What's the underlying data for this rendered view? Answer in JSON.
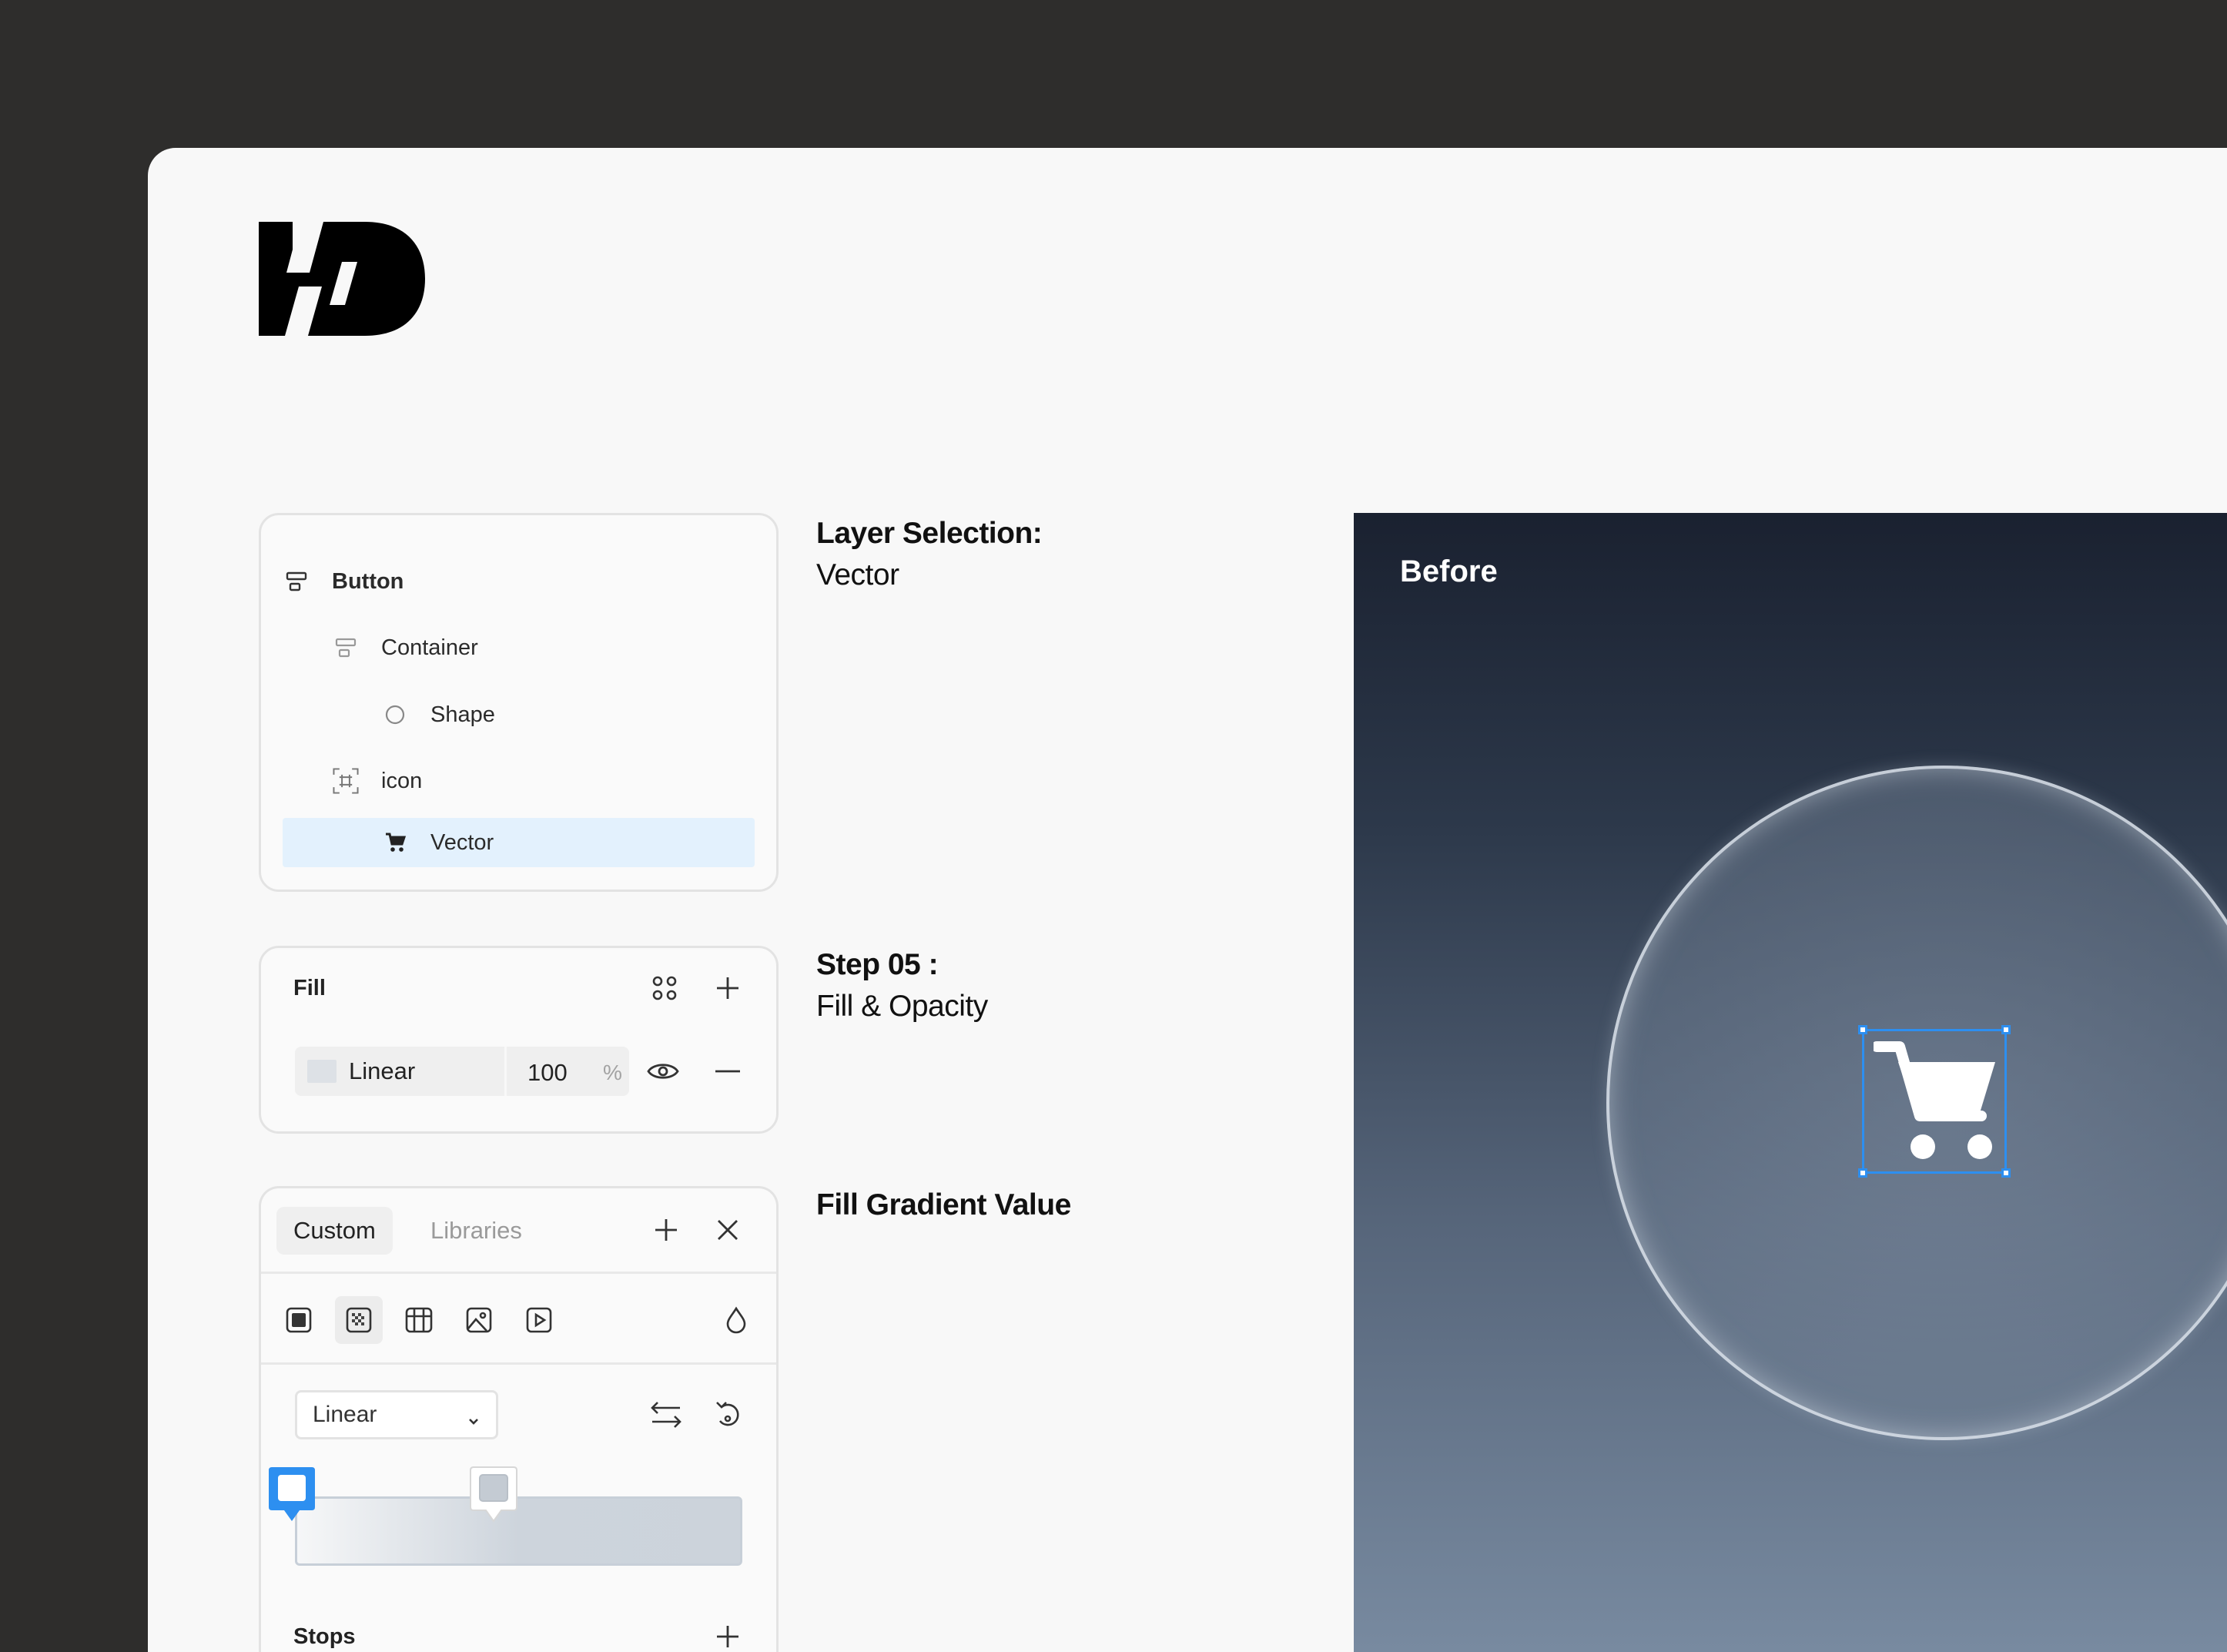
{
  "layers": {
    "items": [
      {
        "label": "Button"
      },
      {
        "label": "Container"
      },
      {
        "label": "Shape"
      },
      {
        "label": "icon"
      },
      {
        "label": "Vector"
      }
    ],
    "selected": "Vector"
  },
  "fill_panel": {
    "title": "Fill",
    "type": "Linear",
    "opacity": "100",
    "opacity_unit": "%"
  },
  "gradient_panel": {
    "tabs": [
      "Custom",
      "Libraries"
    ],
    "active_tab": "Custom",
    "gradient_type": "Linear",
    "stops_label": "Stops"
  },
  "steps": [
    {
      "heading": "Layer Selection:",
      "sub": "Vector"
    },
    {
      "heading": "Step 05 :",
      "sub": "Fill & Opacity"
    },
    {
      "heading": "Fill Gradient Value",
      "sub": ""
    }
  ],
  "preview": {
    "label": "Before"
  },
  "colors": {
    "accent": "#2d8ff0",
    "selection_bg": "#e3f1fd",
    "outer_bg": "#2e2d2c",
    "stage_bg": "#f8f8f8",
    "preview_top": "#1a2130",
    "preview_bottom": "#788aa0"
  },
  "icons": [
    "frame-stack-icon",
    "circle-icon",
    "frame-grid-icon",
    "cart-icon",
    "styles-icon",
    "plus-icon",
    "eye-icon",
    "minus-icon",
    "close-icon",
    "solid-fill-icon",
    "gradient-fill-icon",
    "pattern-fill-icon",
    "image-fill-icon",
    "video-fill-icon",
    "drop-icon",
    "swap-icon",
    "rotate-icon",
    "chevron-down-icon"
  ]
}
